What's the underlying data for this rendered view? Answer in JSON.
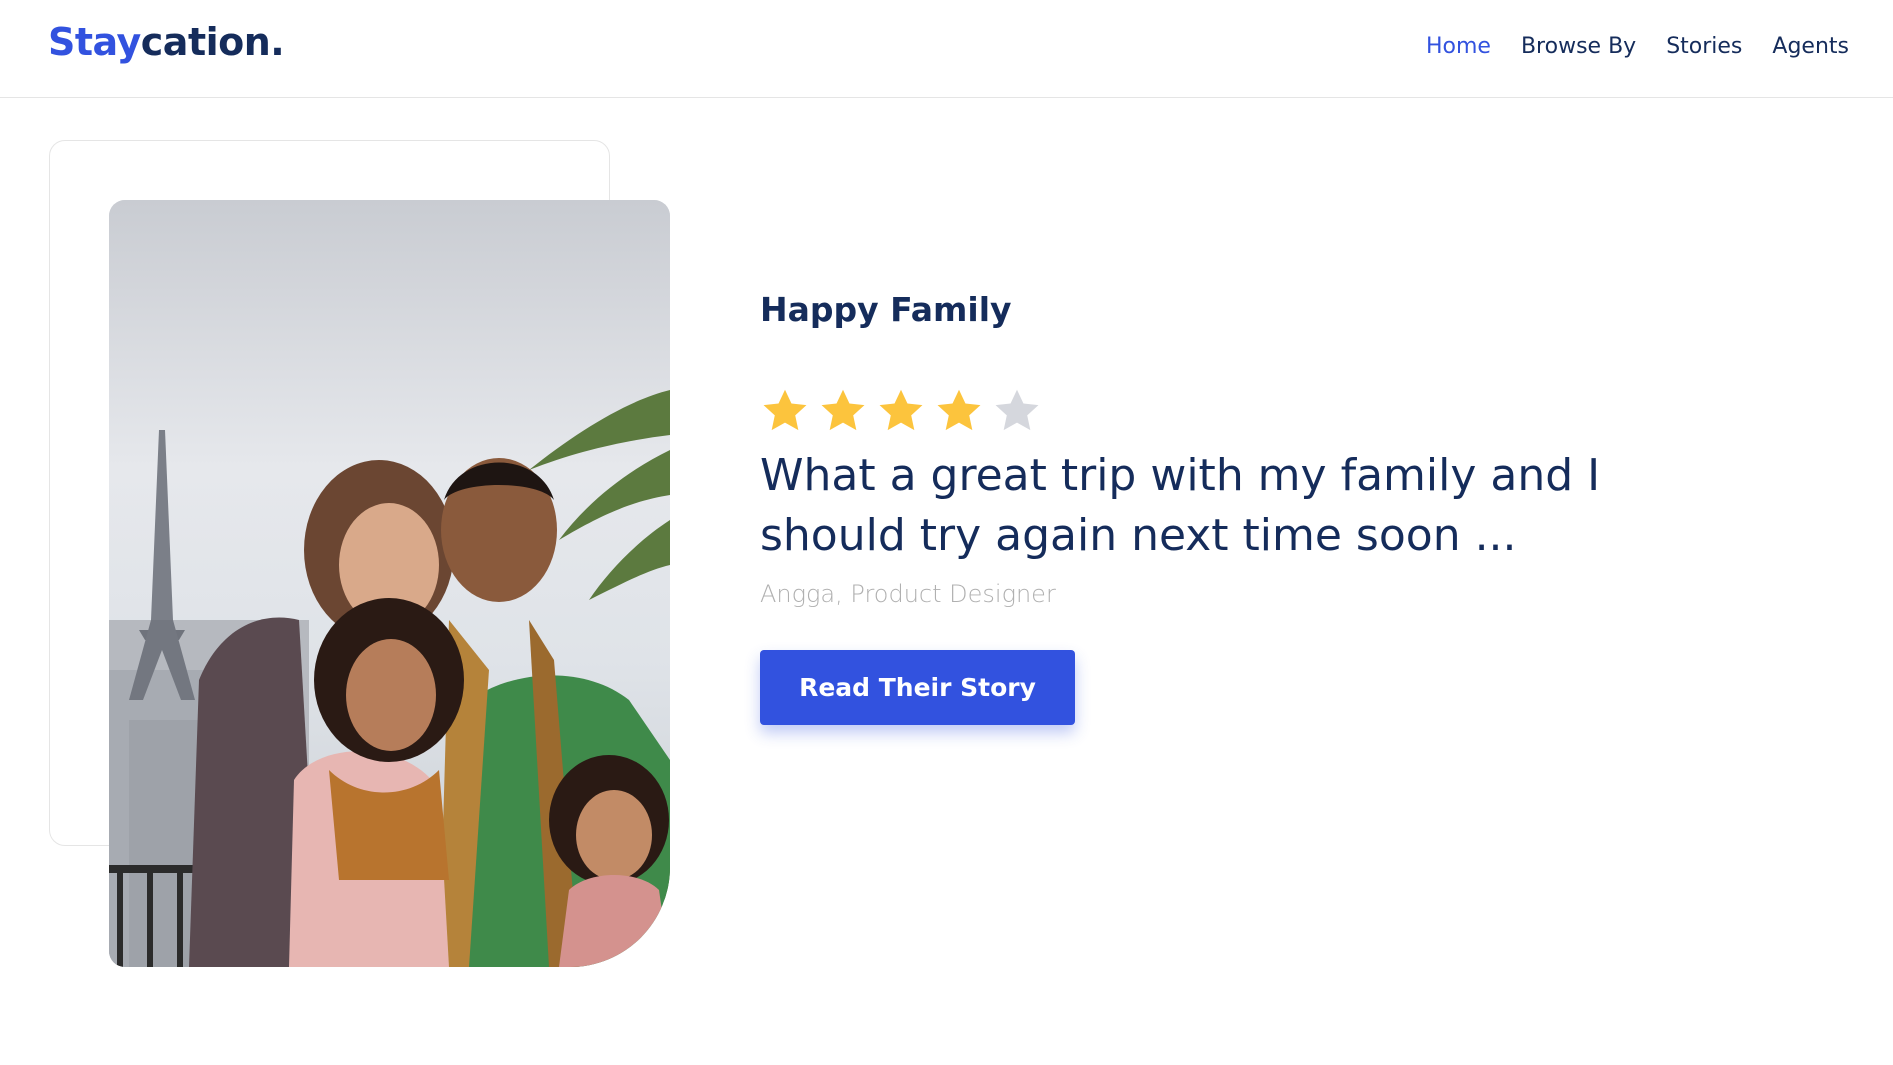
{
  "brand": {
    "accent_text": "Stay",
    "rest_text": "cation."
  },
  "nav": {
    "items": [
      {
        "label": "Home",
        "active": true
      },
      {
        "label": "Browse By",
        "active": false
      },
      {
        "label": "Stories",
        "active": false
      },
      {
        "label": "Agents",
        "active": false
      }
    ]
  },
  "testimonial": {
    "title": "Happy Family",
    "rating": 4,
    "rating_max": 5,
    "quote": "What a great trip with my family and I should try again next time soon ...",
    "author": "Angga, Product Designer",
    "cta_label": "Read Their Story"
  },
  "colors": {
    "primary": "#3252df",
    "navy": "#152c5b",
    "star_filled": "#fcc43d",
    "star_empty": "#d5d7dd",
    "muted_text": "#b0b0b0"
  },
  "icons": {
    "star_filled": "star-filled-icon",
    "star_empty": "star-empty-icon"
  }
}
